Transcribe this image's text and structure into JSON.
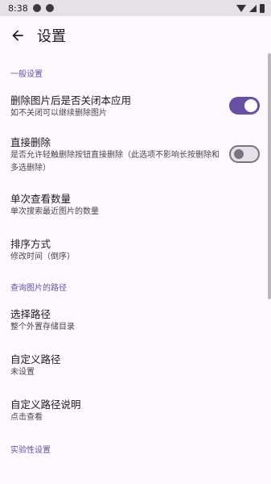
{
  "status_bar": {
    "time": "8:38"
  },
  "app_bar": {
    "title": "设置"
  },
  "sections": [
    {
      "header": "一般设置"
    },
    {
      "header": "查询图片的路径"
    },
    {
      "header": "实验性设置"
    }
  ],
  "items": {
    "close_after_delete": {
      "title": "删除图片后是否关闭本应用",
      "subtitle": "如不关闭可以继续删除图片",
      "enabled": true
    },
    "direct_delete": {
      "title": "直接删除",
      "subtitle": "是否允许轻触删除按钮直接删除（此选项不影响长按删除和多选删除）",
      "enabled": false
    },
    "single_count": {
      "title": "单次查看数量",
      "subtitle": "单次搜索最近图片的数量"
    },
    "sort_order": {
      "title": "排序方式",
      "subtitle": "修改时间（倒序）"
    },
    "select_path": {
      "title": "选择路径",
      "subtitle": "整个外置存储目录"
    },
    "custom_path": {
      "title": "自定义路径",
      "subtitle": "未设置"
    },
    "custom_path_help": {
      "title": "自定义路径说明",
      "subtitle": "点击查看"
    }
  },
  "colors": {
    "accent": "#6750a4",
    "background": "#fcf8fd"
  }
}
